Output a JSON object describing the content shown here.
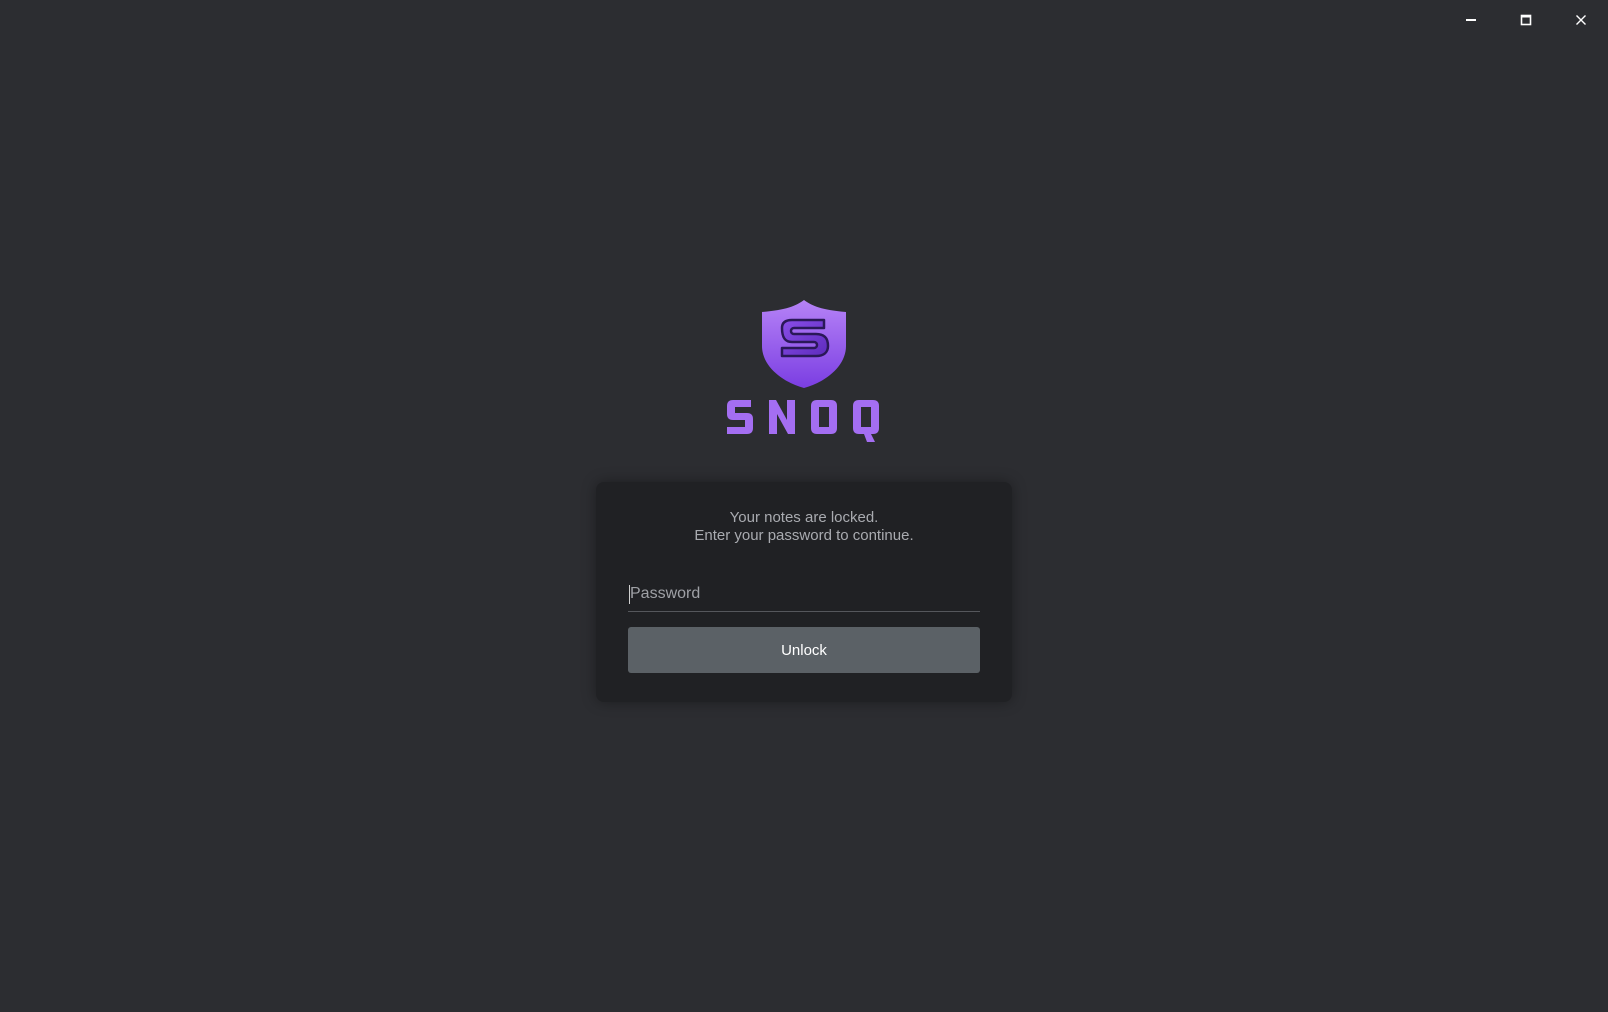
{
  "window": {
    "controls": [
      {
        "name": "minimize-icon"
      },
      {
        "name": "maximize-icon"
      },
      {
        "name": "close-icon"
      }
    ]
  },
  "logo": {
    "wordmark": "SNOQ",
    "icon": "shield-s-icon",
    "colors": {
      "purple_light": "#b27ef5",
      "purple_dark": "#7a3fe0"
    }
  },
  "lock_card": {
    "message_line1": "Your notes are locked.",
    "message_line2": "Enter your password to continue.",
    "password_placeholder": "Password",
    "password_value": "",
    "unlock_label": "Unlock"
  },
  "colors": {
    "background": "#2c2d31",
    "card": "#202124",
    "button": "#5b6166"
  }
}
